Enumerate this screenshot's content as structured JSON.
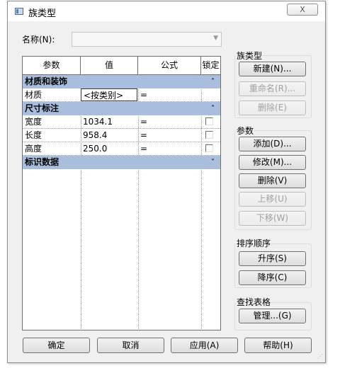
{
  "window": {
    "title": "族类型",
    "close_label": "X"
  },
  "name_field": {
    "label": "名称(N):",
    "value": ""
  },
  "grid": {
    "headers": {
      "param": "参数",
      "value": "值",
      "formula": "公式",
      "lock": "锁定"
    },
    "groups": [
      {
        "title": "材质和装饰",
        "rows": [
          {
            "param": "材质",
            "value": "<按类别>",
            "formula": "="
          }
        ]
      },
      {
        "title": "尺寸标注",
        "rows": [
          {
            "param": "宽度",
            "value": "1034.1",
            "formula": "=",
            "locked": false
          },
          {
            "param": "长度",
            "value": "958.4",
            "formula": "=",
            "locked": false
          },
          {
            "param": "高度",
            "value": "250.0",
            "formula": "=",
            "locked": false
          }
        ]
      },
      {
        "title": "标识数据",
        "rows": []
      }
    ],
    "collapse_icon": "double-chevron-up-icon",
    "expand_icon": "double-chevron-down-icon"
  },
  "family_types": {
    "title": "族类型",
    "new": "新建(N)...",
    "rename": "重命名(R)...",
    "delete": "删除(E)"
  },
  "params": {
    "title": "参数",
    "add": "添加(D)...",
    "modify": "修改(M)...",
    "delete": "删除(V)",
    "move_up": "上移(U)",
    "move_down": "下移(W)"
  },
  "sort": {
    "title": "排序顺序",
    "ascending": "升序(S)",
    "descending": "降序(C)"
  },
  "lookup": {
    "title": "查找表格",
    "manage": "管理...(G)"
  },
  "footer": {
    "ok": "确定",
    "cancel": "取消",
    "apply": "应用(A)",
    "help": "帮助(H)"
  }
}
